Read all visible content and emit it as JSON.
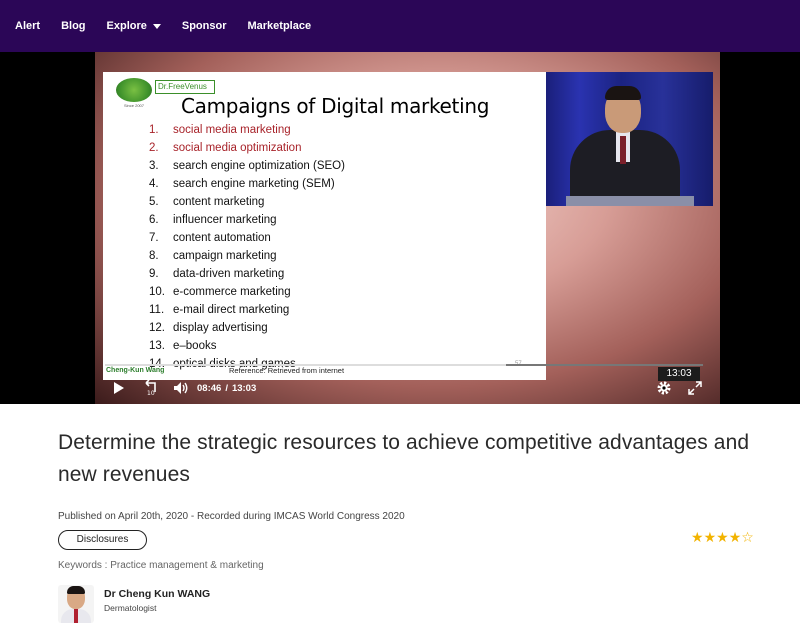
{
  "nav": {
    "items": [
      "Alert",
      "Blog",
      "Explore",
      "Sponsor",
      "Marketplace"
    ]
  },
  "video": {
    "slide": {
      "logo_small": "Since 2007",
      "logo_brand": "Dr.FreeVenus",
      "title": "Campaigns of Digital marketing",
      "items": [
        {
          "num": "1.",
          "text": "social media marketing"
        },
        {
          "num": "2.",
          "text": "social media optimization"
        },
        {
          "num": "3.",
          "text": "search engine optimization (SEO)"
        },
        {
          "num": "4.",
          "text": "search engine marketing (SEM)"
        },
        {
          "num": "5.",
          "text": "content marketing"
        },
        {
          "num": "6.",
          "text": "influencer marketing"
        },
        {
          "num": "7.",
          "text": "content automation"
        },
        {
          "num": "8.",
          "text": "campaign marketing"
        },
        {
          "num": "9.",
          "text": "data-driven marketing"
        },
        {
          "num": "10.",
          "text": "e-commerce marketing"
        },
        {
          "num": "11.",
          "text": "e-mail direct marketing"
        },
        {
          "num": "12.",
          "text": "display advertising"
        },
        {
          "num": "13.",
          "text": "e–books"
        },
        {
          "num": "14.",
          "text": "optical disks and games"
        }
      ],
      "footer_name": "Cheng-Kun Wang",
      "footer_ref": "Reference: Retrieved from internet",
      "page_num": "57"
    },
    "duration_tip": "13:03",
    "current_time": "08:46",
    "separator": "/",
    "total_time": "13:03",
    "progress": 0.67,
    "replay_label": "10"
  },
  "content": {
    "title": "Determine the strategic resources to achieve competitive advantages and new revenues",
    "published": "Published on April 20th, 2020 - Recorded during IMCAS World Congress 2020",
    "disclosures_label": "Disclosures",
    "rating": 4,
    "rating_max": 5,
    "keywords": "Keywords : Practice management & marketing",
    "author_name": "Dr Cheng Kun WANG",
    "author_role": "Dermatologist"
  },
  "colors": {
    "nav_bg": "#2b0657",
    "star": "#f2b300",
    "highlight_item": "#a8232a"
  }
}
